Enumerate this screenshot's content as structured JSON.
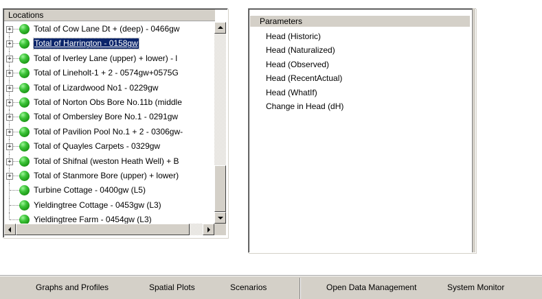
{
  "locations": {
    "header": "Locations",
    "items": [
      {
        "label": "Total of Cow Lane Dt + (deep) - 0466gw",
        "expandable": true,
        "selected": false
      },
      {
        "label": "Total of Harrington - 0158gw",
        "expandable": true,
        "selected": true
      },
      {
        "label": "Total of Iverley Lane (upper) + lower) - l",
        "expandable": true,
        "selected": false
      },
      {
        "label": "Total of Lineholt-1 + 2 - 0574gw+0575G",
        "expandable": true,
        "selected": false
      },
      {
        "label": "Total of Lizardwood No1 - 0229gw",
        "expandable": true,
        "selected": false
      },
      {
        "label": "Total of Norton Obs Bore No.11b (middle",
        "expandable": true,
        "selected": false
      },
      {
        "label": "Total of Ombersley Bore No.1 - 0291gw",
        "expandable": true,
        "selected": false
      },
      {
        "label": "Total of Pavilion Pool No.1 + 2 - 0306gw-",
        "expandable": true,
        "selected": false
      },
      {
        "label": "Total of Quayles Carpets - 0329gw",
        "expandable": true,
        "selected": false
      },
      {
        "label": "Total of Shifnal (weston Heath Well) + B",
        "expandable": true,
        "selected": false
      },
      {
        "label": "Total of Stanmore Bore (upper) + lower)",
        "expandable": true,
        "selected": false
      },
      {
        "label": "Turbine Cottage - 0400gw (L5)",
        "expandable": false,
        "selected": false
      },
      {
        "label": "Yieldingtree Cottage - 0453gw (L3)",
        "expandable": false,
        "selected": false
      },
      {
        "label": "Yieldingtree Farm - 0454gw (L3)",
        "expandable": false,
        "selected": false
      }
    ],
    "expander_symbol": "+",
    "status_color": "#22aa1c"
  },
  "parameters": {
    "header": "Parameters",
    "items": [
      "Head (Historic)",
      "Head (Naturalized)",
      "Head (Observed)",
      "Head (RecentActual)",
      "Head (WhatIf)",
      "Change in Head (dH)"
    ]
  },
  "toolbar": {
    "graphs_label": "Graphs and Profiles",
    "spatial_label": "Spatial Plots",
    "scenarios_label": "Scenarios",
    "data_mgmt_label": "Open Data Management",
    "monitor_label": "System Monitor"
  },
  "colors": {
    "selection_bg": "#0a246a",
    "panel_gray": "#d4d0c8"
  }
}
